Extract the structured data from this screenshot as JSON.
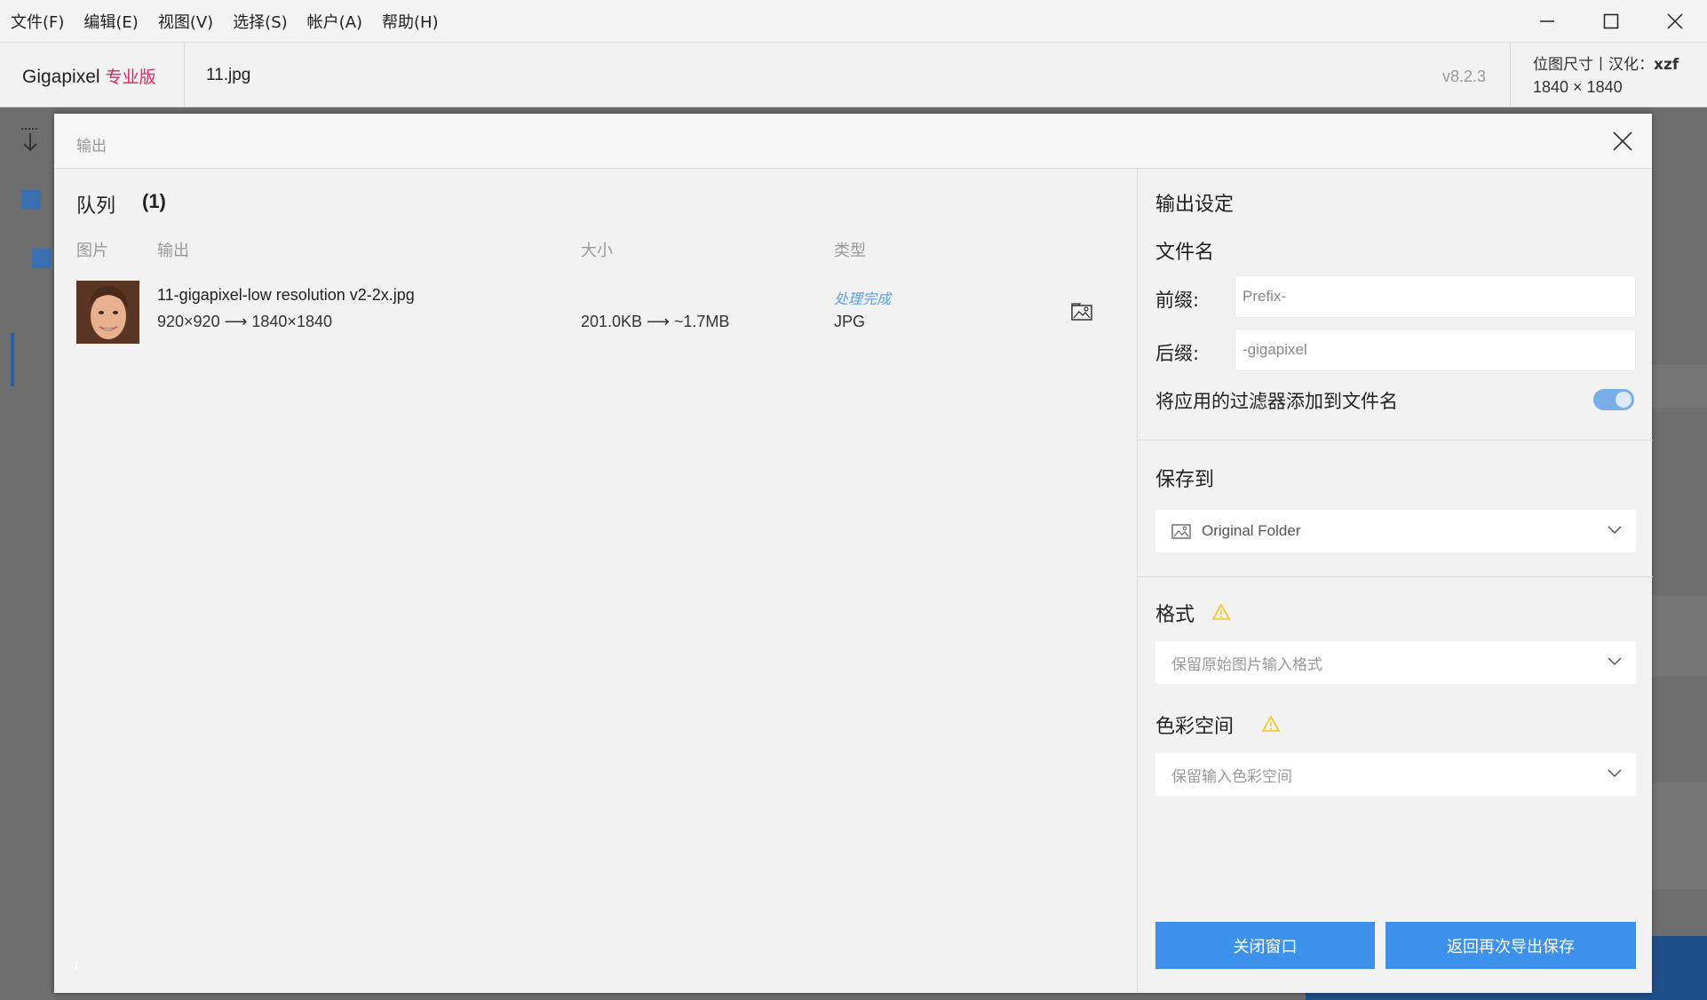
{
  "menubar": {
    "items": [
      "文件(F)",
      "编辑(E)",
      "视图(V)",
      "选择(S)",
      "帐户(A)",
      "帮助(H)"
    ]
  },
  "window_controls": {
    "icons": [
      "minimize-icon",
      "maximize-icon",
      "close-icon"
    ]
  },
  "header": {
    "app_name": "Gigapixel",
    "edition": "专业版",
    "filename": "11.jpg",
    "version": "v8.2.3",
    "dim_label": "位图尺寸丨汉化：",
    "dim_credit": "xzf",
    "dimensions": "1840 × 1840"
  },
  "dialog": {
    "title": "输出",
    "queue": {
      "title": "队列",
      "count": "(1)",
      "columns": {
        "image": "图片",
        "output": "输出",
        "size": "大小",
        "type": "类型"
      },
      "rows": [
        {
          "output_name": "11-gigapixel-low resolution v2-2x.jpg",
          "dims": "920×920 ⟶ 1840×1840",
          "sizes": "201.0KB ⟶ ~1.7MB",
          "status": "处理完成",
          "type": "JPG"
        }
      ]
    },
    "settings": {
      "title": "输出设定",
      "filename_section": "文件名",
      "prefix_label": "前缀:",
      "prefix_placeholder": "Prefix-",
      "suffix_label": "后缀:",
      "suffix_value": "-gigapixel",
      "append_filters_label": "将应用的过滤器添加到文件名",
      "append_filters_on": true,
      "save_to_label": "保存到",
      "save_to_value": "Original Folder",
      "format_label": "格式",
      "format_value": "保留原始图片输入格式",
      "colorspace_label": "色彩空间",
      "colorspace_value": "保留输入色彩空间",
      "close_button": "关闭窗口",
      "reexport_button": "返回再次导出保存"
    }
  },
  "colors": {
    "accent": "#3d91ea",
    "pro_label": "#e0245e",
    "status": "#5aa0e6",
    "warning": "#f5c518"
  }
}
